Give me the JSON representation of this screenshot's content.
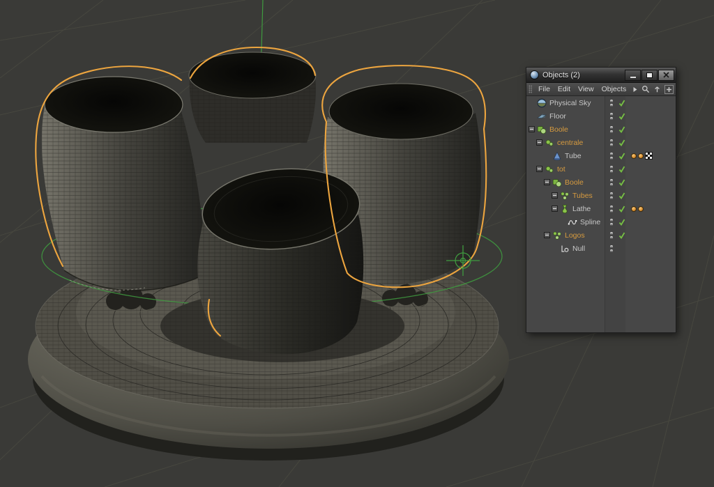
{
  "colors": {
    "selection": "#eda53f",
    "axis_green": "#3f9b3f",
    "check_green": "#76c043",
    "orange_label": "#d79b3f",
    "viewport_bg": "#3a3a37",
    "panel_bg": "#4a4a4a"
  },
  "panel": {
    "title": "Objects (2)",
    "window_buttons": [
      "minimize-icon",
      "maximize-icon",
      "close-icon"
    ],
    "menu": {
      "items": [
        "File",
        "Edit",
        "View",
        "Objects"
      ]
    },
    "menubar_icons": [
      "menu-overflow-arrow-icon",
      "search-icon",
      "up-arrow-icon",
      "add-icon"
    ],
    "tree": [
      {
        "label": "Physical Sky",
        "indent": 0,
        "expander": false,
        "icon": "physical-sky",
        "highlighted": false,
        "check": true,
        "tags": []
      },
      {
        "label": "Floor",
        "indent": 0,
        "expander": false,
        "icon": "floor",
        "highlighted": false,
        "check": true,
        "tags": []
      },
      {
        "label": "Boole",
        "indent": 0,
        "expander": true,
        "icon": "boole",
        "highlighted": true,
        "check": true,
        "tags": []
      },
      {
        "label": "centrale",
        "indent": 1,
        "expander": true,
        "icon": "group",
        "highlighted": true,
        "check": true,
        "tags": []
      },
      {
        "label": "Tube",
        "indent": 2,
        "expander": false,
        "icon": "tube",
        "highlighted": false,
        "check": true,
        "tags": [
          "dot",
          "dot",
          "texture"
        ]
      },
      {
        "label": "tot",
        "indent": 1,
        "expander": true,
        "icon": "group",
        "highlighted": true,
        "check": true,
        "tags": []
      },
      {
        "label": "Boole",
        "indent": 2,
        "expander": true,
        "icon": "boole",
        "highlighted": true,
        "check": true,
        "tags": []
      },
      {
        "label": "Tubes",
        "indent": 3,
        "expander": true,
        "icon": "array",
        "highlighted": true,
        "check": true,
        "tags": []
      },
      {
        "label": "Lathe",
        "indent": 3,
        "expander": true,
        "icon": "lathe",
        "highlighted": false,
        "check": true,
        "tags": [
          "dot",
          "dot"
        ]
      },
      {
        "label": "Spline",
        "indent": 4,
        "expander": false,
        "icon": "spline",
        "highlighted": false,
        "check": true,
        "tags": []
      },
      {
        "label": "Logos",
        "indent": 2,
        "expander": true,
        "icon": "array",
        "highlighted": true,
        "check": true,
        "tags": []
      },
      {
        "label": "Null",
        "indent": 3,
        "expander": false,
        "icon": "null",
        "highlighted": false,
        "check": false,
        "tags": []
      }
    ]
  }
}
